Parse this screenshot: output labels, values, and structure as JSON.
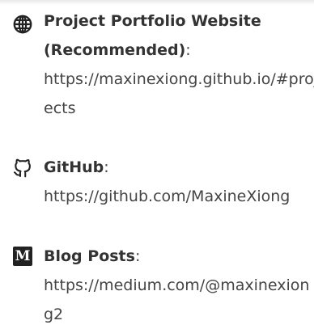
{
  "links": [
    {
      "icon": "globe-icon",
      "title": "Project Portfolio Website (Recommended)",
      "colon": ":",
      "url": "https://maxinexiong.github.io/#projects"
    },
    {
      "icon": "github-icon",
      "title": "GitHub",
      "colon": ":",
      "url": "https://github.com/MaxineXiong"
    },
    {
      "icon": "medium-icon",
      "icon_letter": "M",
      "title": "Blog Posts",
      "colon": ":",
      "url": "https://medium.com/@maxinexiong2"
    }
  ]
}
